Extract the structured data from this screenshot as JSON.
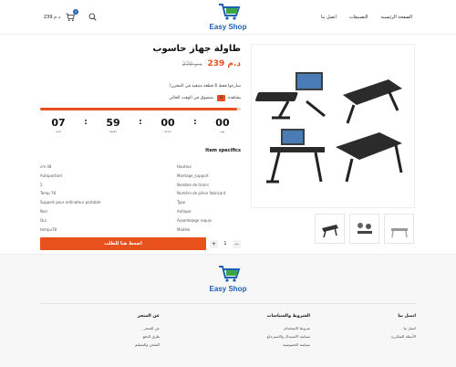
{
  "header": {
    "nav": [
      "الصفحة الرئيسية",
      "التصنيفات",
      "اتصل بنا"
    ],
    "logo_text": "Easy Shop",
    "cart_price": "239 د.م",
    "cart_count": "0"
  },
  "product": {
    "title": "طاولة جهاز حاسوب",
    "price": "239 د.م",
    "old_price": "279 د.م",
    "stock_text": "سارعوا فقط 6 قطعة متبقية في المخزن!",
    "viewers_label": "يشاهده",
    "viewers_count": "8",
    "viewers_suffix": "متسوق في الوقت الحالي.",
    "stock_progress": 0.98,
    "countdown": [
      {
        "value": "00",
        "label": "يوم"
      },
      {
        "value": "00",
        "label": "ساعة"
      },
      {
        "value": "59",
        "label": "دقيقة"
      },
      {
        "value": "07",
        "label": "ثانية"
      }
    ],
    "specs_title": "Item specifics",
    "specs": [
      {
        "key": "Hauteur",
        "value": "cm 48"
      },
      {
        "key": "Montage_support",
        "value": "Autoportant"
      },
      {
        "key": "Nombre de tiroirs",
        "value": "2"
      },
      {
        "key": "Numéro de pièce fabricant",
        "value": "Temp 78"
      },
      {
        "key": "Type",
        "value": "Support pour ordinateur portable"
      },
      {
        "key": "Antique",
        "value": "Non"
      },
      {
        "key": "Assemblage requis",
        "value": "Oui"
      },
      {
        "key": "Modèle",
        "value": "tempu78"
      }
    ],
    "order_button": "اضغط هنا للطلب",
    "qty_minus": "−",
    "qty_plus": "+",
    "qty_value": "1"
  },
  "footer": {
    "logo_text": "Easy Shop",
    "columns": [
      {
        "title": "اتصل بنا",
        "items": [
          "اتصل بنا",
          "الأسئلة المتكررة"
        ]
      },
      {
        "title": "الشروط والسياسات",
        "items": [
          "شروط الاستخدام",
          "سياسة الاستبدال والاسترجاع",
          "سياسة الخصوصية"
        ]
      },
      {
        "title": "عن المتجر",
        "items": [
          "عن المتجر",
          "طرق الدفع",
          "الشحن والتسليم"
        ]
      }
    ]
  },
  "colors": {
    "accent": "#e8501c",
    "brand_blue": "#1e5fb4",
    "brand_green": "#3aa648"
  }
}
